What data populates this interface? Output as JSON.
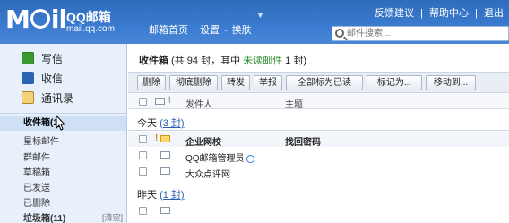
{
  "header": {
    "logo_text_1": "M",
    "logo_text_2": "il",
    "brand": "QQ邮箱",
    "domain": "mail.qq.com",
    "nav": [
      "邮箱首页",
      "|",
      "设置",
      "-",
      "换肤"
    ],
    "links": [
      "|",
      "反馈建议",
      "|",
      "帮助中心",
      "|",
      "退出"
    ],
    "search_placeholder": "邮件搜索..."
  },
  "sidebar": {
    "main_items": [
      {
        "label": "写信",
        "icon": "write-icon"
      },
      {
        "label": "收信",
        "icon": "inbox-icon"
      },
      {
        "label": "通讯录",
        "icon": "contacts-icon"
      }
    ],
    "folders": [
      {
        "label": "收件箱(1)",
        "active": true
      },
      {
        "label": "星标邮件"
      },
      {
        "label": "群邮件"
      },
      {
        "label": "草稿箱"
      },
      {
        "label": "已发送"
      },
      {
        "label": "已删除"
      },
      {
        "label": "垃圾箱(11)"
      }
    ],
    "clear_label": "[清空]"
  },
  "main": {
    "title_folder": "收件箱",
    "title_mid": " (共 94 封，其中 ",
    "title_unread": "未读邮件",
    "title_end": " 1 封)",
    "toolbar": [
      "删除",
      "彻底删除",
      "转发",
      "举报",
      "全部标为已读",
      "标记为...",
      "移动到..."
    ],
    "columns": {
      "sender": "发件人",
      "subject": "主题"
    },
    "groups": [
      {
        "label": "今天",
        "count": "(3 封)"
      },
      {
        "label": "昨天",
        "count": "(1 封)"
      }
    ],
    "rows": [
      {
        "sender": "企业网校",
        "subject": "找回密码",
        "unread": true
      },
      {
        "sender": "QQ邮箱管理员",
        "subject": ""
      },
      {
        "sender": "大众点评网",
        "subject": ""
      }
    ]
  },
  "colors": {
    "header_blue": "#3a7bd0",
    "sidebar_bg": "#e8f0fb",
    "unread_green": "#2f8f2f"
  }
}
